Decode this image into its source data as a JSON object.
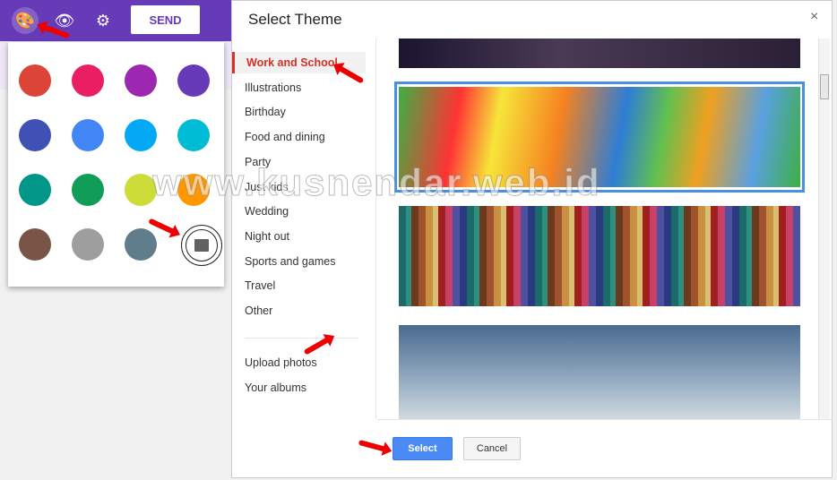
{
  "toolbar": {
    "send_label": "SEND",
    "icons": [
      "palette-icon",
      "eye-icon",
      "gear-icon"
    ],
    "accent": "#673ab7"
  },
  "palette": {
    "colors": [
      "#db4437",
      "#e91e63",
      "#9c27b0",
      "#673ab7",
      "#3f51b5",
      "#4285f4",
      "#03a9f4",
      "#00bcd4",
      "#009688",
      "#0f9d58",
      "#cddc39",
      "#ff9800",
      "#795548",
      "#9e9e9e",
      "#607d8b"
    ],
    "image_icon": "image-icon"
  },
  "dialog": {
    "title": "Select Theme",
    "close_label": "×",
    "categories": [
      "Work and School",
      "Illustrations",
      "Birthday",
      "Food and dining",
      "Party",
      "Just kids",
      "Wedding",
      "Night out",
      "Sports and games",
      "Travel",
      "Other"
    ],
    "active_category": "Work and School",
    "sources": [
      "Upload photos",
      "Your albums"
    ],
    "select_label": "Select",
    "cancel_label": "Cancel"
  },
  "watermark": "www.kusnendar.web.id"
}
